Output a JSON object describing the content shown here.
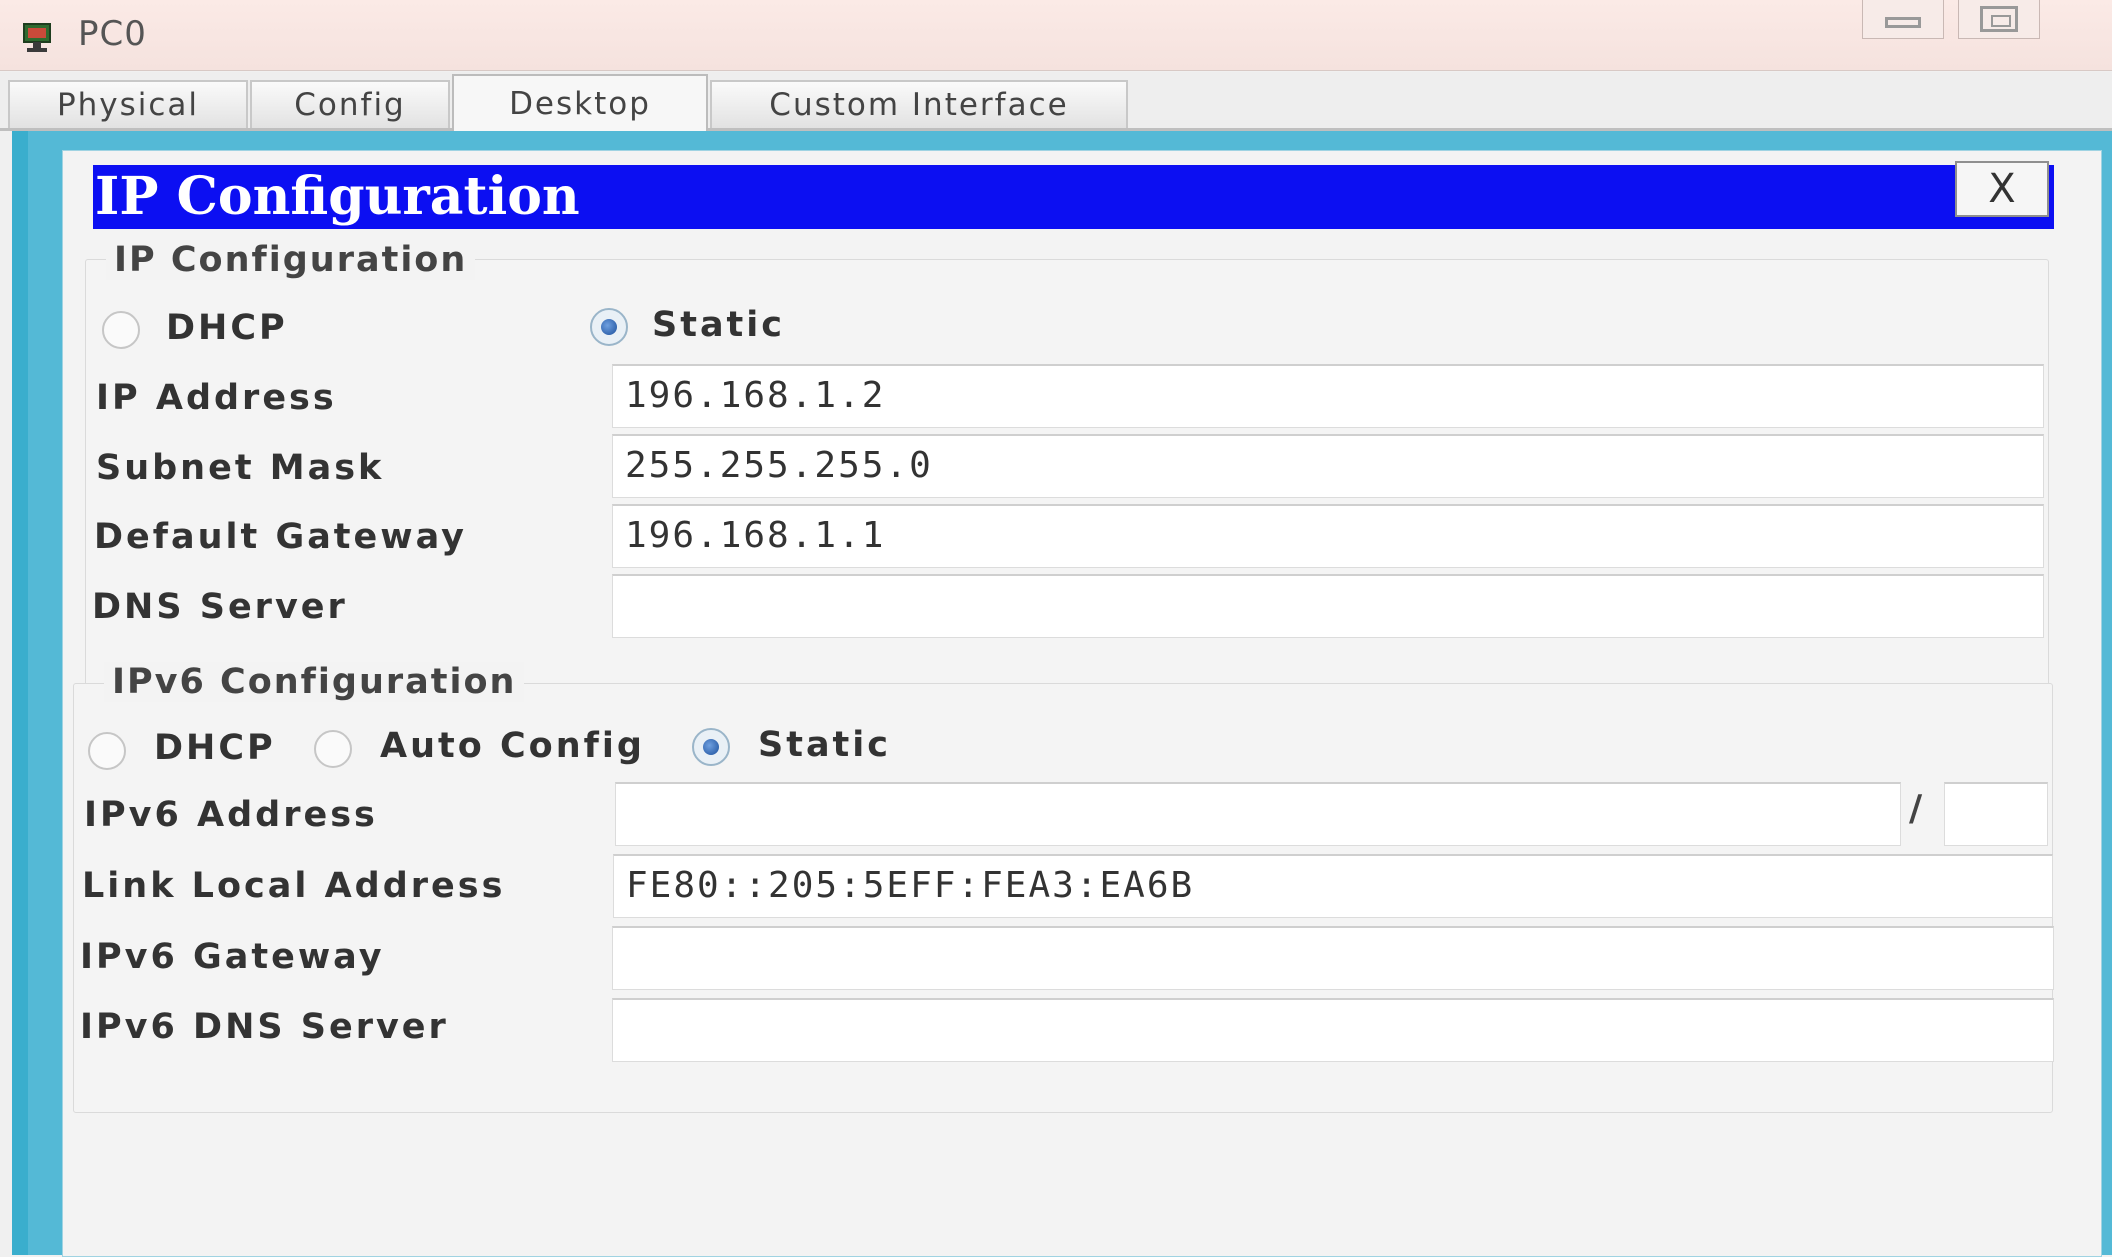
{
  "window": {
    "title": "PC0"
  },
  "tabs": [
    {
      "label": "Physical"
    },
    {
      "label": "Config"
    },
    {
      "label": "Desktop"
    },
    {
      "label": "Custom Interface"
    }
  ],
  "dialog": {
    "title": "IP Configuration",
    "close_label": "X",
    "ipv4": {
      "legend": "IP Configuration",
      "dhcp_label": "DHCP",
      "static_label": "Static",
      "mode": "Static",
      "ip_address_label": "IP Address",
      "ip_address": "196.168.1.2",
      "subnet_mask_label": "Subnet Mask",
      "subnet_mask": "255.255.255.0",
      "gateway_label": "Default Gateway",
      "gateway": "196.168.1.1",
      "dns_label": "DNS Server",
      "dns": ""
    },
    "ipv6": {
      "legend": "IPv6 Configuration",
      "dhcp_label": "DHCP",
      "auto_label": "Auto Config",
      "static_label": "Static",
      "mode": "Static",
      "address_label": "IPv6 Address",
      "address": "",
      "prefix_separator": "/",
      "prefix": "",
      "link_local_label": "Link Local Address",
      "link_local": "FE80::205:5EFF:FEA3:EA6B",
      "gateway_label": "IPv6 Gateway",
      "gateway": "",
      "dns_label": "IPv6 DNS Server",
      "dns": ""
    }
  },
  "colors": {
    "title_bar": "#0c0ff2",
    "desktop_bg": "#3aaecd"
  }
}
